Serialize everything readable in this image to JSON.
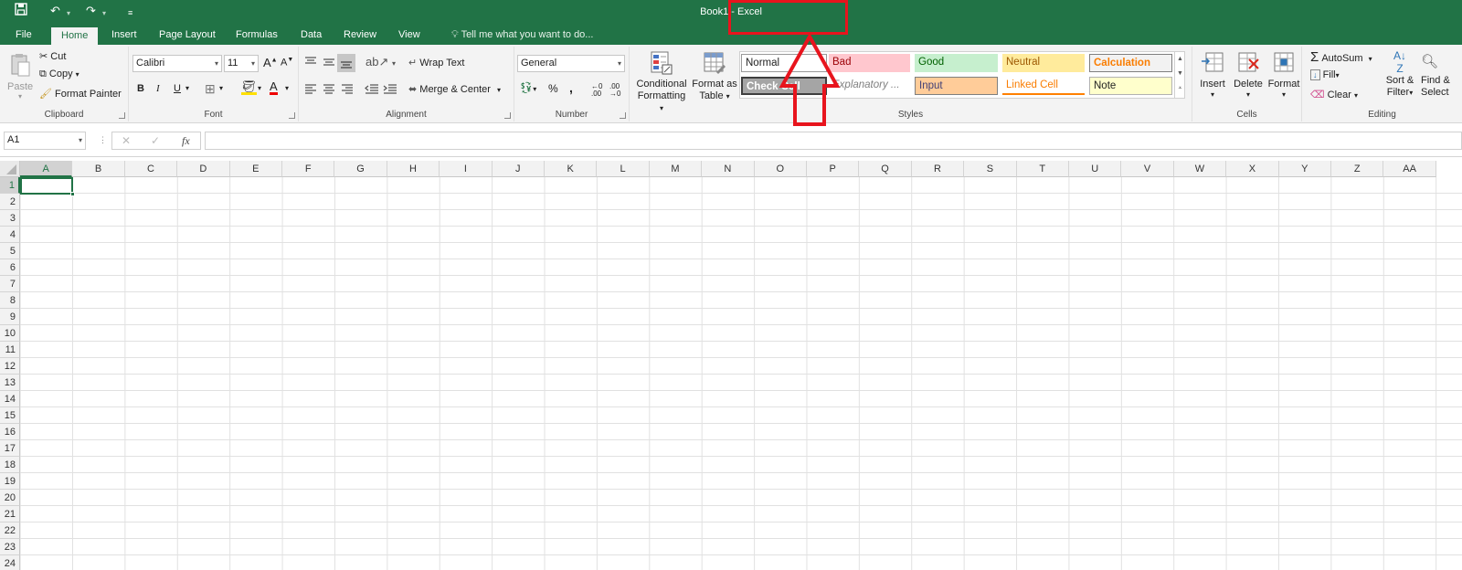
{
  "titlebar": {
    "title": "Book1 - Excel"
  },
  "tabs": [
    "File",
    "Home",
    "Insert",
    "Page Layout",
    "Formulas",
    "Data",
    "Review",
    "View"
  ],
  "tell_me": "Tell me what you want to do...",
  "clipboard": {
    "paste": "Paste",
    "cut": "Cut",
    "copy": "Copy",
    "format_painter": "Format Painter",
    "label": "Clipboard"
  },
  "font": {
    "name": "Calibri",
    "size": "11",
    "bold": "B",
    "italic": "I",
    "underline": "U",
    "grow": "A",
    "shrink": "A",
    "font_color": "A",
    "label": "Font"
  },
  "alignment": {
    "wrap_text": "Wrap Text",
    "merge_center": "Merge & Center",
    "label": "Alignment"
  },
  "number": {
    "format": "General",
    "percent": "%",
    "comma": ",",
    "label": "Number"
  },
  "styles": {
    "conditional": "Conditional",
    "formatting": "Formatting",
    "format_as": "Format as",
    "table": "Table",
    "label": "Styles",
    "cells": [
      "Normal",
      "Bad",
      "Good",
      "Neutral",
      "Calculation",
      "Check Cell",
      "Explanatory ...",
      "Input",
      "Linked Cell",
      "Note"
    ]
  },
  "cells_group": {
    "insert": "Insert",
    "delete": "Delete",
    "format": "Format",
    "label": "Cells"
  },
  "editing": {
    "autosum": "AutoSum",
    "fill": "Fill",
    "clear": "Clear",
    "sort": "Sort &",
    "filter": "Filter",
    "find": "Find &",
    "select": "Select",
    "label": "Editing"
  },
  "formula_bar": {
    "name_box": "A1",
    "fx": "fx",
    "value": ""
  },
  "columns": [
    "A",
    "B",
    "C",
    "D",
    "E",
    "F",
    "G",
    "H",
    "I",
    "J",
    "K",
    "L",
    "M",
    "N",
    "O",
    "P",
    "Q",
    "R",
    "S",
    "T",
    "U",
    "V",
    "W",
    "X",
    "Y",
    "Z",
    "AA"
  ],
  "rows": [
    "1",
    "2",
    "3",
    "4",
    "5",
    "6",
    "7",
    "8",
    "9",
    "10",
    "11",
    "12",
    "13",
    "14",
    "15",
    "16",
    "17",
    "18",
    "19",
    "20",
    "21",
    "22",
    "23",
    "24"
  ],
  "colors": {
    "excel_green": "#217346",
    "annotation_red": "#e8141d"
  }
}
